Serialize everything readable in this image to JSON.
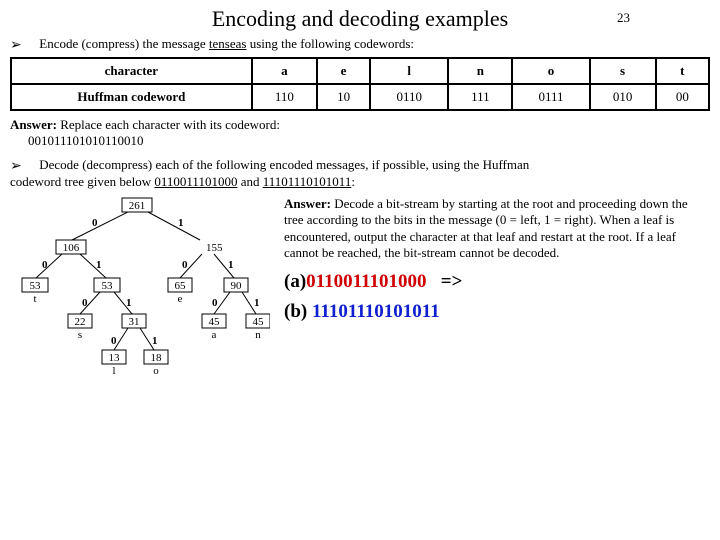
{
  "header": {
    "title": "Encoding and decoding examples",
    "page_number": "23"
  },
  "bullets": {
    "encode": {
      "prefix": "Encode (compress) the message ",
      "word": "tenseas",
      "suffix": " using the following codewords:"
    },
    "decode": {
      "line1": "Decode (decompress) each of the following encoded messages, if possible, using the Huffman",
      "line2_prefix": "codeword tree given below ",
      "seq_a": "0110011101000",
      "mid": " and ",
      "seq_b": "11101110101011",
      "line2_suffix": ":"
    }
  },
  "table": {
    "headers": [
      "character",
      "a",
      "e",
      "l",
      "n",
      "o",
      "s",
      "t"
    ],
    "row_label": "Huffman codeword",
    "codewords": [
      "110",
      "10",
      "0110",
      "111",
      "0111",
      "010",
      "00"
    ]
  },
  "answer_encode": {
    "label": "Answer:",
    "text": " Replace each character with its codeword:",
    "bits": "001011101010110010"
  },
  "answer_decode": {
    "label": "Answer:",
    "text": " Decode a bit-stream by starting at the root and proceeding down the tree according to the bits in the message (0 = left, 1 = right). When a leaf is encountered, output the character at that leaf and restart at the root. If a leaf cannot be reached, the bit-stream cannot be decoded."
  },
  "results": {
    "a_prefix": "(a)",
    "a_bits": "0110011101000",
    "a_arrow": "=>",
    "b_prefix": "(b) ",
    "b_bits": "11101110101011"
  },
  "tree": {
    "root": "261",
    "edge0": "0",
    "edge1": "1",
    "left_106": "106",
    "right_155": "155",
    "n53a": "53",
    "char_t": "t",
    "n53b": "53",
    "n22": "22",
    "char_s": "s",
    "n31": "31",
    "n13": "13",
    "char_l": "l",
    "n18": "18",
    "char_o": "o",
    "n65": "65",
    "char_e": "e",
    "n90": "90",
    "n45a": "45",
    "char_a": "a",
    "n45b": "45",
    "char_n": "n"
  }
}
